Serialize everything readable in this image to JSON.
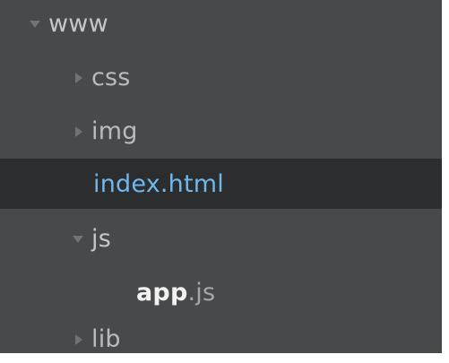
{
  "tree": {
    "root": {
      "label": "www",
      "expanded": true
    },
    "items": [
      {
        "label": "css",
        "type": "folder",
        "expanded": false
      },
      {
        "label": "img",
        "type": "folder",
        "expanded": false
      },
      {
        "label": "index.html",
        "type": "file",
        "selected": true
      },
      {
        "label": "js",
        "type": "folder",
        "expanded": true
      },
      {
        "label_base": "app",
        "label_ext": ".js",
        "type": "file"
      },
      {
        "label": "lib",
        "type": "folder",
        "expanded": false
      }
    ]
  },
  "colors": {
    "panel_bg": "#48494a",
    "selected_bg": "#2c2d2e",
    "text": "#b9bcbe",
    "active_file": "#6fb7ec",
    "arrow": "#707275"
  },
  "icons": {
    "expanded": "triangle-down-icon",
    "collapsed": "triangle-right-icon"
  }
}
